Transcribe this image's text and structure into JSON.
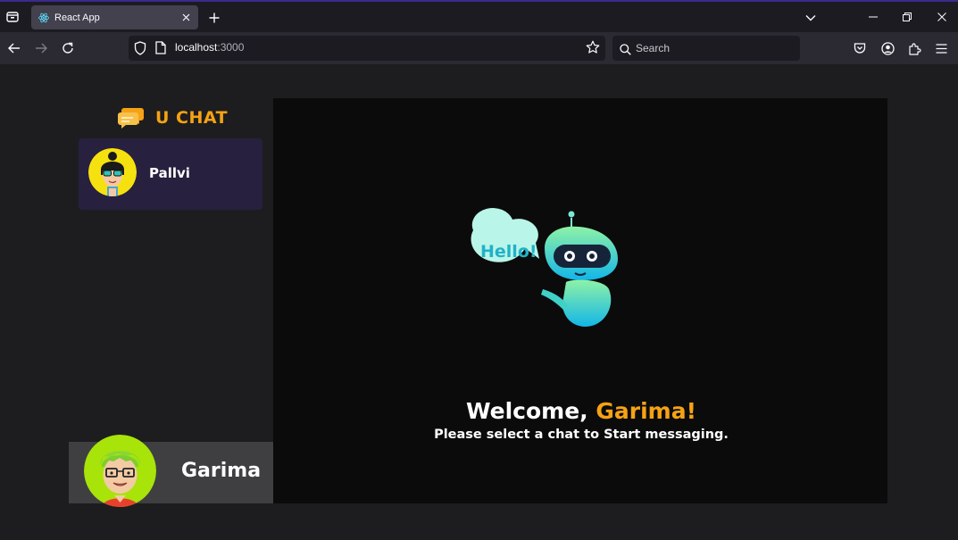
{
  "browser": {
    "tab_title": "React App",
    "url_host": "localhost",
    "url_port": ":3000",
    "search_placeholder": "Search"
  },
  "app": {
    "brand_name": "U CHAT",
    "contacts": [
      {
        "name": "Pallvi"
      }
    ],
    "current_user": {
      "name": "Garima"
    },
    "welcome": {
      "prefix": "Welcome, ",
      "user": "Garima!",
      "subtitle": "Please select a chat to Start messaging."
    },
    "robot_bubble_text": "Hello!"
  },
  "colors": {
    "accent": "#f5a214",
    "sidebar_bg": "#1d1d1f",
    "contact_selected_bg": "#28203f",
    "chat_bg": "#0b0b0b",
    "current_user_bg": "#3f3f41"
  }
}
